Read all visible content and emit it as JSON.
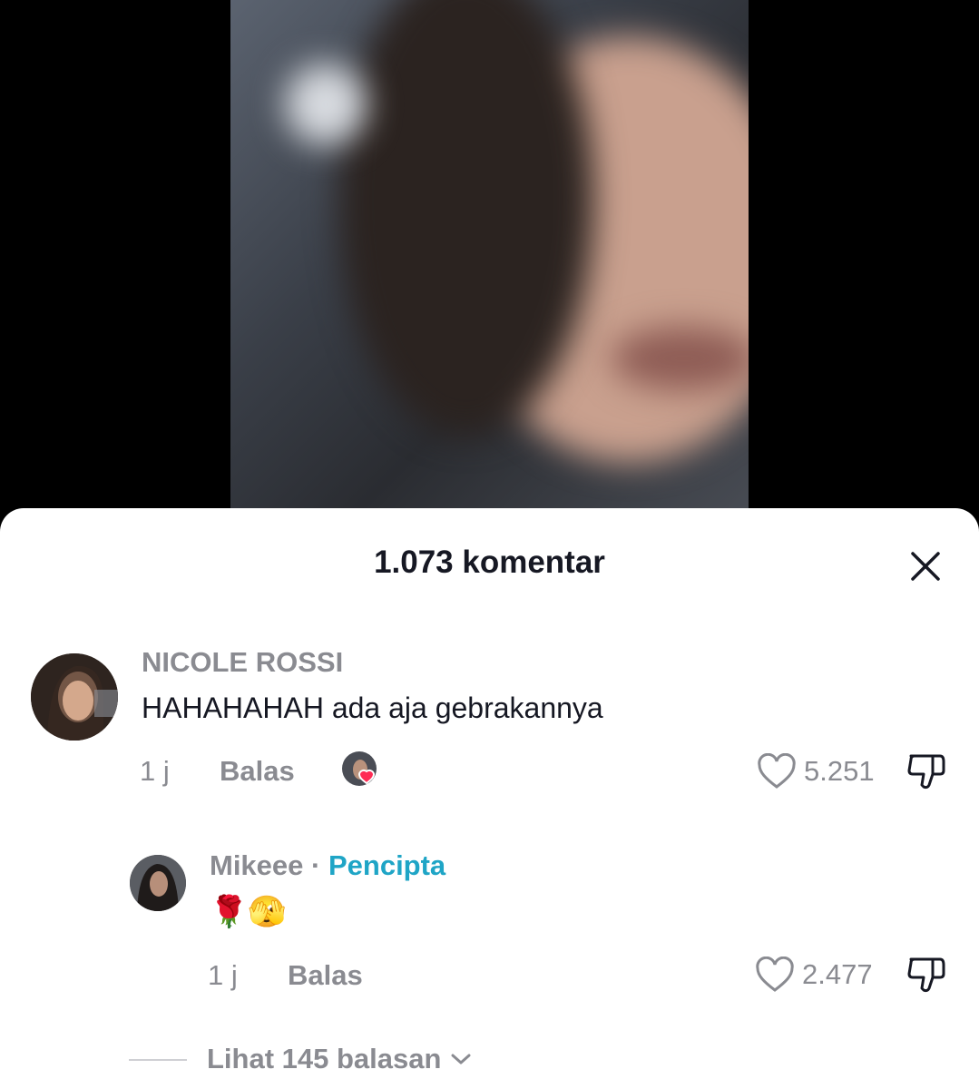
{
  "video": {
    "description_icon": "video-frame"
  },
  "sheet": {
    "title": "1.073 komentar"
  },
  "comment": {
    "username": "NICOLE ROSSI",
    "text": "HAHAHAHAH ada aja gebrakannya",
    "time": "1 j",
    "reply_label": "Balas",
    "likes": "5.251"
  },
  "reply": {
    "username": "Mikeee",
    "separator": " · ",
    "badge": "Pencipta",
    "text": "🌹🫣",
    "time": "1 j",
    "reply_label": "Balas",
    "likes": "2.477"
  },
  "more_replies": {
    "label": "Lihat 145 balasan"
  },
  "colors": {
    "accent_creator": "#1fa5c6",
    "like_heart": "#fe2c55",
    "muted": "#8a8b91"
  }
}
